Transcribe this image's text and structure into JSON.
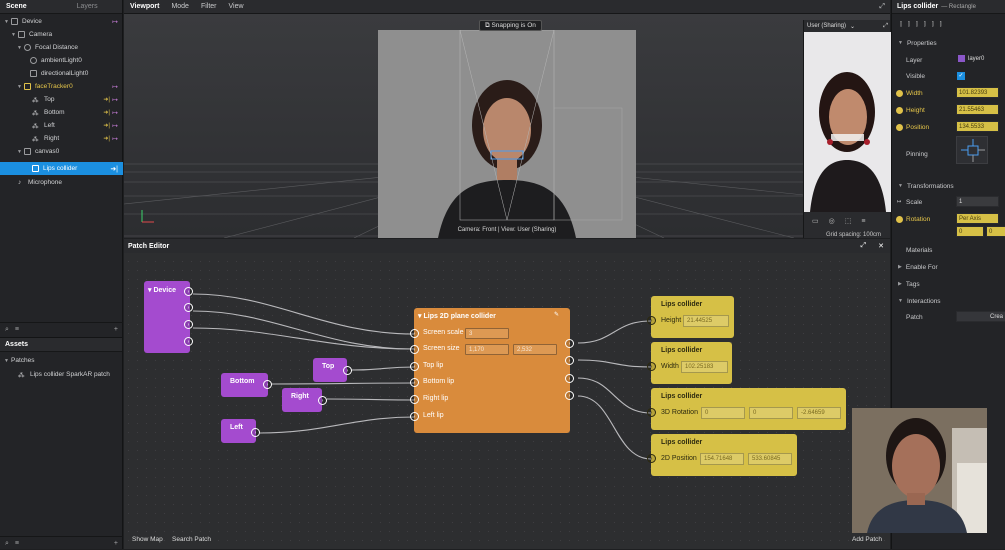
{
  "scene": {
    "tabs": [
      "Scene",
      "Layers"
    ],
    "items": [
      {
        "label": "Device"
      },
      {
        "label": "Camera"
      },
      {
        "label": "Focal Distance"
      },
      {
        "label": "ambientLight0"
      },
      {
        "label": "directionalLight0"
      },
      {
        "label": "faceTracker0"
      },
      {
        "label": "Top"
      },
      {
        "label": "Bottom"
      },
      {
        "label": "Left"
      },
      {
        "label": "Right"
      },
      {
        "label": "canvas0"
      },
      {
        "label": "Lips collider"
      },
      {
        "label": "Microphone"
      }
    ]
  },
  "assets": {
    "title": "Assets",
    "folder": "Patches",
    "item": "Lips collider SparkAR patch"
  },
  "viewport": {
    "title": "Viewport",
    "menu": [
      "Mode",
      "Filter",
      "View"
    ],
    "snapping": "Snapping is On",
    "camera_caption": "Camera: Front | View: User (Sharing)",
    "preview_device": "User (Sharing)",
    "grid_spacing": "Grid spacing: 100cm"
  },
  "patch_editor": {
    "title": "Patch Editor",
    "footer_left": [
      "Show Map",
      "Search Patch"
    ],
    "footer_right": "Add Patch",
    "device_node": "Device",
    "main_node": {
      "title": "Lips 2D plane collider",
      "inputs": [
        "Screen scale",
        "Screen size",
        "Top lip",
        "Bottom lip",
        "Right lip",
        "Left lip"
      ],
      "screen_scale": "3",
      "screen_size_x": "1,170",
      "screen_size_y": "2,532"
    },
    "side_nodes": [
      "Top",
      "Bottom",
      "Right",
      "Left"
    ],
    "outputs": [
      {
        "title": "Lips collider",
        "label": "Height",
        "values": [
          "21.44525"
        ]
      },
      {
        "title": "Lips collider",
        "label": "Width",
        "values": [
          "102.25183"
        ]
      },
      {
        "title": "Lips collider",
        "label": "3D Rotation",
        "values": [
          "0",
          "0",
          "-2.64659"
        ]
      },
      {
        "title": "Lips collider",
        "label": "2D Position",
        "values": [
          "154.71648",
          "533.60845"
        ]
      }
    ]
  },
  "inspector": {
    "title": "Lips collider",
    "subtitle": "— Rectangle",
    "properties": "Properties",
    "layer_label": "Layer",
    "layer_value": "layer0",
    "visible_label": "Visible",
    "width_label": "Width",
    "width_value": "101.82393",
    "height_label": "Height",
    "height_value": "21.55463",
    "position_label": "Position",
    "position_value": "134.5533",
    "pinning_label": "Pinning",
    "transformations": "Transformations",
    "scale_label": "Scale",
    "scale_value": "1",
    "rotation_label": "Rotation",
    "rotation_value": "Per Axis",
    "rotation_x": "0",
    "rotation_y": "0",
    "materials": "Materials",
    "enable_for": "Enable For",
    "tags": "Tags",
    "interactions": "Interactions",
    "patch_label": "Patch",
    "patch_button": "Crea"
  },
  "colors": {
    "selection": "#1b8fe0",
    "patch_purple": "#a44bcf",
    "patch_orange": "#d98b3c",
    "patch_yellow": "#d6c046"
  }
}
